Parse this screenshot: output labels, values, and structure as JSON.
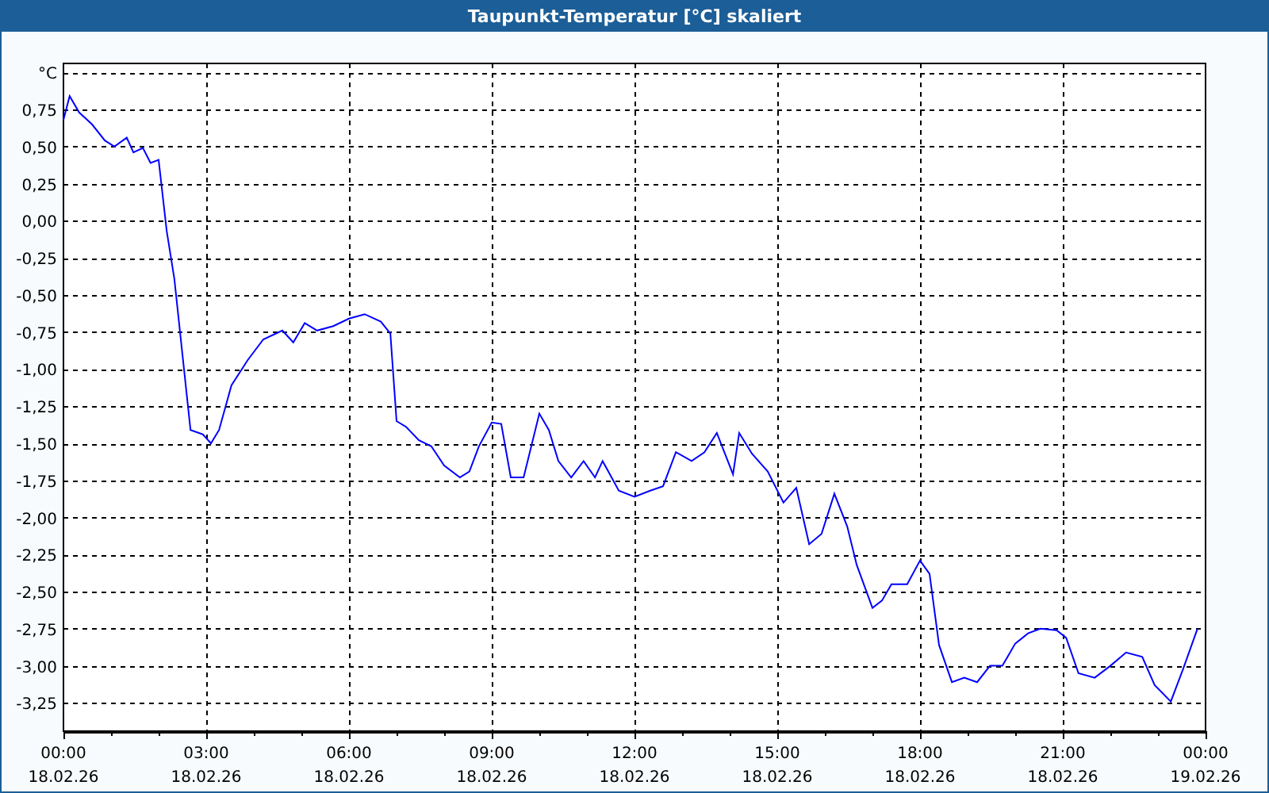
{
  "window": {
    "title": "Taupunkt-Temperatur [°C] skaliert"
  },
  "chart": {
    "x_axis_dates": [
      "18.02.26",
      "18.02.26",
      "18.02.26",
      "18.02.26",
      "18.02.26",
      "18.02.26",
      "18.02.26",
      "18.02.26",
      "19.02.26"
    ],
    "chart_data": {
      "type": "line",
      "grid": true,
      "xlim": [
        0,
        24
      ],
      "ylim": [
        -3.44,
        1.06
      ],
      "xticks": [
        {
          "value": 0,
          "label": "00:00"
        },
        {
          "value": 3,
          "label": "03:00"
        },
        {
          "value": 6,
          "label": "06:00"
        },
        {
          "value": 9,
          "label": "09:00"
        },
        {
          "value": 12,
          "label": "12:00"
        },
        {
          "value": 15,
          "label": "15:00"
        },
        {
          "value": 18,
          "label": "18:00"
        },
        {
          "value": 21,
          "label": "21:00"
        },
        {
          "value": 24,
          "label": "00:00"
        }
      ],
      "yticks": [
        {
          "value": 1,
          "label": "°C"
        },
        {
          "value": 0.75,
          "label": "0,75"
        },
        {
          "value": 0.5,
          "label": "0,50"
        },
        {
          "value": 0.25,
          "label": "0,25"
        },
        {
          "value": 0,
          "label": "0,00"
        },
        {
          "value": -0.25,
          "label": "-0,25"
        },
        {
          "value": -0.5,
          "label": "-0,50"
        },
        {
          "value": -0.75,
          "label": "-0,75"
        },
        {
          "value": -1,
          "label": "-1,00"
        },
        {
          "value": -1.25,
          "label": "-1,25"
        },
        {
          "value": -1.5,
          "label": "-1,50"
        },
        {
          "value": -1.75,
          "label": "-1,75"
        },
        {
          "value": -2,
          "label": "-2,00"
        },
        {
          "value": -2.25,
          "label": "-2,25"
        },
        {
          "value": -2.5,
          "label": "-2,50"
        },
        {
          "value": -2.75,
          "label": "-2,75"
        },
        {
          "value": -3,
          "label": "-3,00"
        },
        {
          "value": -3.25,
          "label": "-3,25"
        }
      ],
      "x": [
        0,
        0.13,
        0.33,
        0.6,
        0.87,
        1.07,
        1.33,
        1.47,
        1.67,
        1.83,
        2,
        2.17,
        2.33,
        2.67,
        2.93,
        3.1,
        3.27,
        3.53,
        3.87,
        4.2,
        4.6,
        4.83,
        5.07,
        5.33,
        5.67,
        6,
        6.33,
        6.67,
        6.87,
        7,
        7.2,
        7.47,
        7.73,
        8,
        8.33,
        8.53,
        8.73,
        9,
        9.2,
        9.4,
        9.67,
        10,
        10.2,
        10.4,
        10.67,
        10.93,
        11.17,
        11.33,
        11.67,
        12,
        12.33,
        12.6,
        12.87,
        13.2,
        13.47,
        13.73,
        14.07,
        14.2,
        14.47,
        14.8,
        15.13,
        15.4,
        15.67,
        15.93,
        16.2,
        16.47,
        16.67,
        17,
        17.2,
        17.4,
        17.73,
        18,
        18.2,
        18.4,
        18.67,
        18.93,
        19.2,
        19.47,
        19.73,
        20,
        20.27,
        20.53,
        20.87,
        21.07,
        21.33,
        21.67,
        22,
        22.33,
        22.67,
        22.93,
        23.27,
        23.53,
        23.83
      ],
      "series": [
        {
          "color": "#0000ff",
          "values": [
            0.68,
            0.84,
            0.73,
            0.65,
            0.54,
            0.5,
            0.56,
            0.46,
            0.49,
            0.39,
            0.41,
            -0.07,
            -0.39,
            -1.41,
            -1.44,
            -1.5,
            -1.41,
            -1.11,
            -0.94,
            -0.8,
            -0.74,
            -0.82,
            -0.69,
            -0.74,
            -0.71,
            -0.66,
            -0.63,
            -0.68,
            -0.76,
            -1.35,
            -1.39,
            -1.48,
            -1.52,
            -1.65,
            -1.73,
            -1.69,
            -1.52,
            -1.36,
            -1.37,
            -1.73,
            -1.73,
            -1.3,
            -1.41,
            -1.62,
            -1.73,
            -1.62,
            -1.73,
            -1.62,
            -1.82,
            -1.86,
            -1.82,
            -1.79,
            -1.56,
            -1.62,
            -1.56,
            -1.43,
            -1.71,
            -1.43,
            -1.57,
            -1.69,
            -1.9,
            -1.8,
            -2.18,
            -2.11,
            -1.84,
            -2.06,
            -2.32,
            -2.61,
            -2.56,
            -2.45,
            -2.45,
            -2.29,
            -2.38,
            -2.86,
            -3.11,
            -3.08,
            -3.11,
            -3,
            -3,
            -2.85,
            -2.78,
            -2.75,
            -2.76,
            -2.81,
            -3.05,
            -3.08,
            -3,
            -2.91,
            -2.94,
            -3.13,
            -3.24,
            -3.02,
            -2.75
          ]
        }
      ]
    }
  }
}
